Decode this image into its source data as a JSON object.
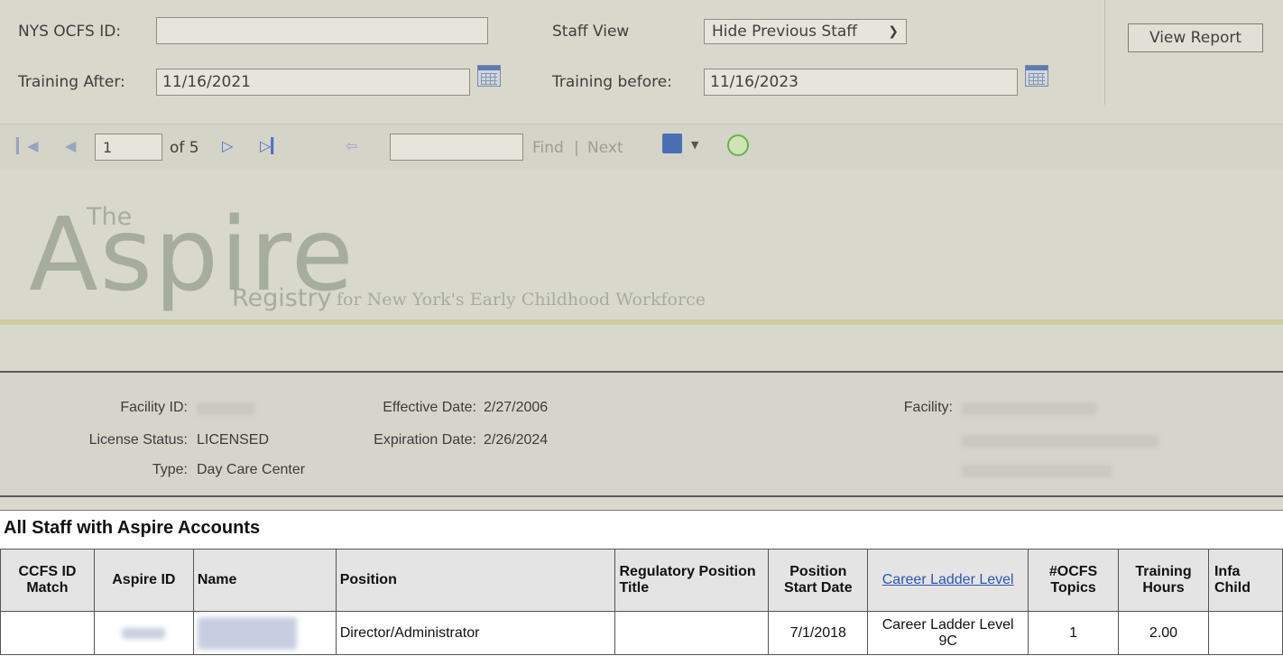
{
  "params": {
    "ocfs_id_label": "NYS OCFS ID:",
    "ocfs_id_value": "",
    "staff_view_label": "Staff View",
    "staff_view_selected": "Hide Previous Staff",
    "training_after_label": "Training After:",
    "training_after_value": "11/16/2021",
    "training_before_label": "Training before:",
    "training_before_value": "11/16/2023",
    "view_report_label": "View Report"
  },
  "toolbar": {
    "page_value": "1",
    "of_text": "of 5",
    "find_label": "Find",
    "separator": "|",
    "next_label": "Next"
  },
  "logo": {
    "the": "The",
    "main": "Aspire",
    "registry": "Registry",
    "tagline": "for New York's Early Childhood Workforce"
  },
  "facility": {
    "facility_id_label": "Facility ID:",
    "license_status_label": "License Status:",
    "license_status_value": "LICENSED",
    "type_label": "Type:",
    "type_value": "Day Care Center",
    "effective_date_label": "Effective Date:",
    "effective_date_value": "2/27/2006",
    "expiration_date_label": "Expiration Date:",
    "expiration_date_value": "2/26/2024",
    "facility_label": "Facility:"
  },
  "staff": {
    "title": "All Staff with Aspire Accounts",
    "headers": {
      "ccfs_match": "CCFS ID Match",
      "aspire_id": "Aspire ID",
      "name": "Name",
      "position": "Position",
      "regulatory": "Regulatory Position Title",
      "start_date": "Position Start Date",
      "career_ladder": "Career Ladder Level",
      "ocfs_topics": "#OCFS Topics",
      "training_hours": "Training Hours",
      "infant_child": "Infa Child"
    },
    "rows": [
      {
        "ccfs_match": "",
        "position": "Director/Administrator",
        "regulatory": "",
        "start_date": "7/1/2018",
        "career_ladder": "Career Ladder Level 9C",
        "ocfs_topics": "1",
        "training_hours": "2.00",
        "infant_child": ""
      }
    ]
  }
}
